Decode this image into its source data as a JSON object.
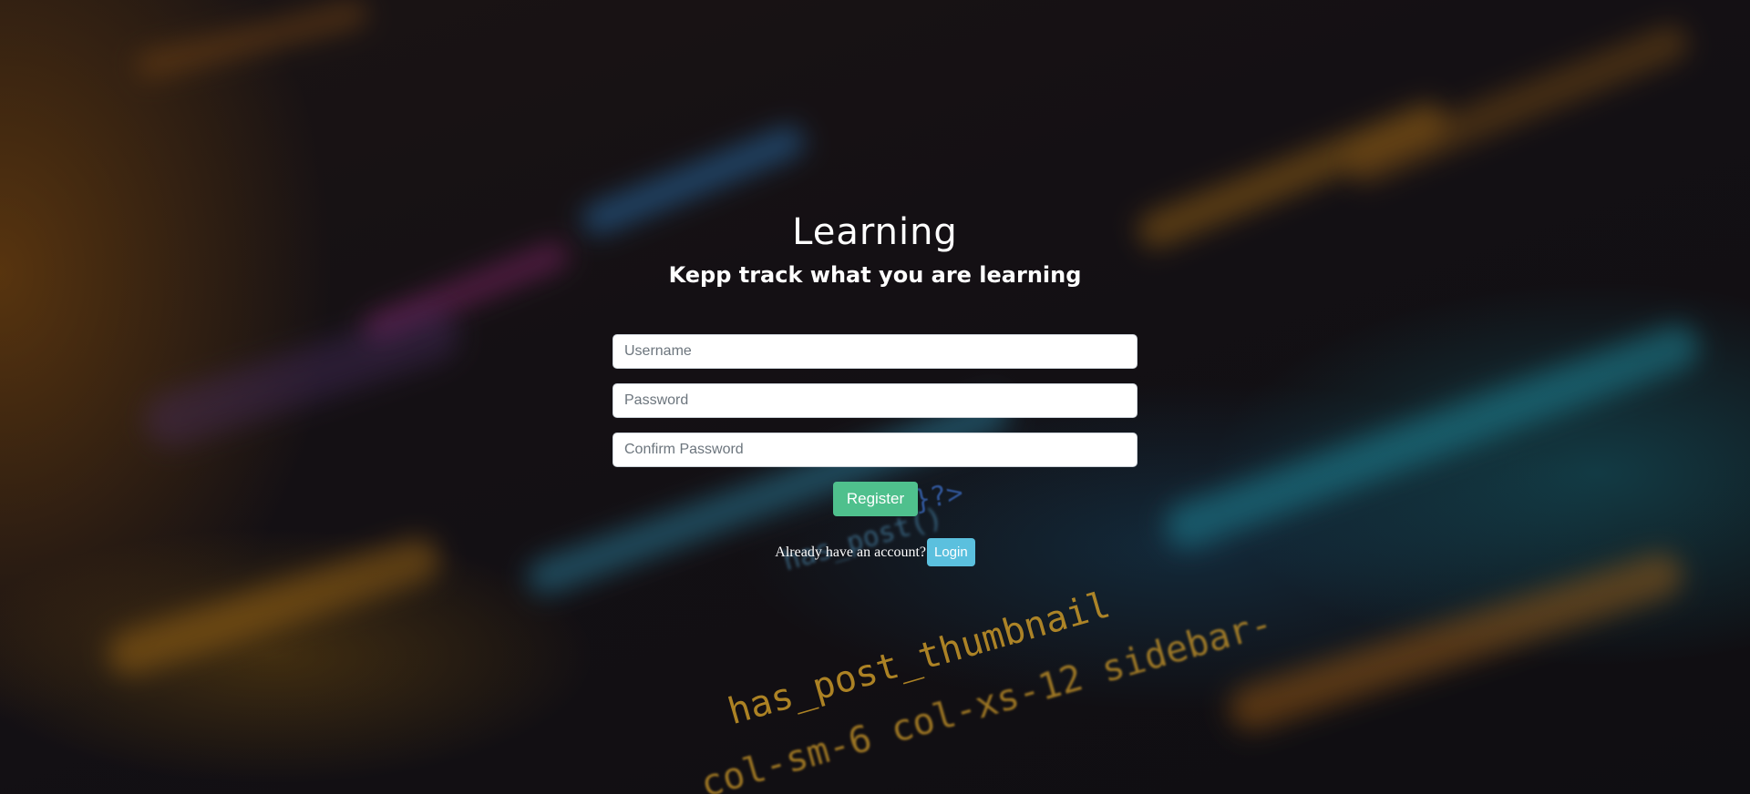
{
  "header": {
    "title": "Learning",
    "subtitle": "Kepp track what you are learning"
  },
  "form": {
    "username_placeholder": "Username",
    "password_placeholder": "Password",
    "confirm_password_placeholder": "Confirm Password",
    "register_label": "Register"
  },
  "login_prompt": {
    "text": "Already have an account?",
    "login_label": "Login"
  },
  "background": {
    "code_fragments": [
      "has_post_thumbnail",
      "col-sm-6 col-xs-12 sidebar-",
      "has_post()",
      "}?>"
    ]
  },
  "colors": {
    "register_button": "#4fc08d",
    "login_button": "#5bc0de",
    "background": "#120f12"
  }
}
